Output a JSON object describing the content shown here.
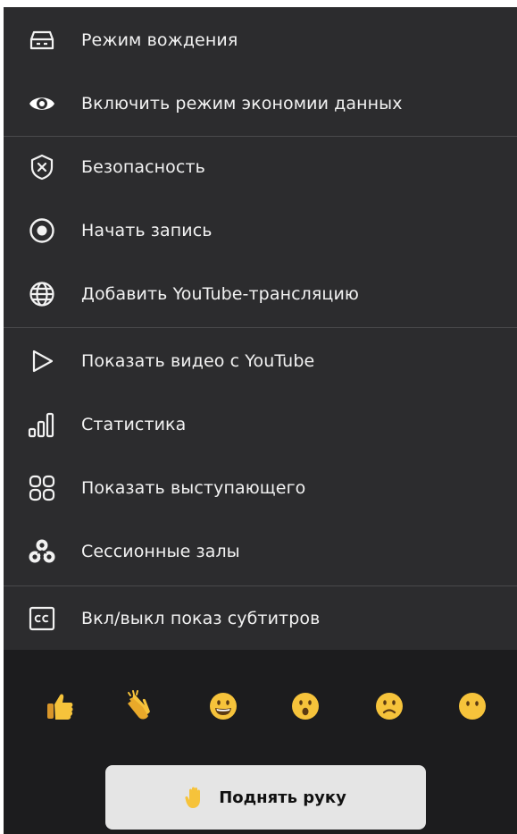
{
  "menu": {
    "items": [
      {
        "label": "Режим вождения",
        "icon": "car-icon"
      },
      {
        "label": "Включить режим экономии данных",
        "icon": "eye-icon"
      },
      {
        "label": "Безопасность",
        "icon": "shield-x-icon"
      },
      {
        "label": "Начать запись",
        "icon": "record-icon"
      },
      {
        "label": "Добавить YouTube-трансляцию",
        "icon": "globe-icon"
      },
      {
        "label": "Показать видео с YouTube",
        "icon": "play-icon"
      },
      {
        "label": "Статистика",
        "icon": "bar-stats-icon"
      },
      {
        "label": "Показать выступающего",
        "icon": "grid-icon"
      },
      {
        "label": "Сессионные залы",
        "icon": "breakout-rooms-icon"
      },
      {
        "label": "Вкл/выкл показ субтитров",
        "icon": "cc-icon"
      }
    ]
  },
  "reactions": [
    {
      "icon": "thumbs-up-emoji"
    },
    {
      "icon": "clapping-hands-emoji"
    },
    {
      "icon": "grinning-face-emoji"
    },
    {
      "icon": "surprised-face-emoji"
    },
    {
      "icon": "frowning-face-emoji"
    },
    {
      "icon": "neutral-face-emoji"
    }
  ],
  "raise_hand": {
    "label": "Поднять руку",
    "icon": "raised-hand-emoji"
  },
  "colors": {
    "menu_bg": "#2c2c2e",
    "panel_bg": "#1c1c1e",
    "text": "#f2f2f2",
    "emoji_yellow": "#f6c33b",
    "button_bg": "#e5e5e5"
  }
}
